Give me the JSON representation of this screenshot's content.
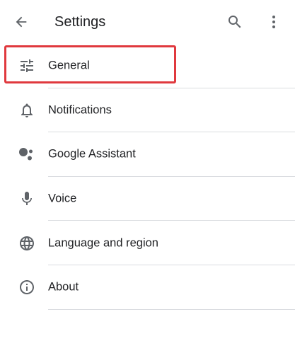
{
  "app_bar": {
    "title": "Settings",
    "back_icon": "arrow-back-icon",
    "search_icon": "search-icon",
    "more_icon": "more-vert-icon"
  },
  "items": [
    {
      "label": "General",
      "icon": "tune-icon"
    },
    {
      "label": "Notifications",
      "icon": "bell-icon"
    },
    {
      "label": "Google Assistant",
      "icon": "assistant-icon"
    },
    {
      "label": "Voice",
      "icon": "mic-icon"
    },
    {
      "label": "Language and region",
      "icon": "globe-icon"
    },
    {
      "label": "About",
      "icon": "info-icon"
    }
  ],
  "colors": {
    "highlight": "#e0393e",
    "icon": "#5f6368",
    "text": "#202124",
    "divider": "#dadce0"
  }
}
